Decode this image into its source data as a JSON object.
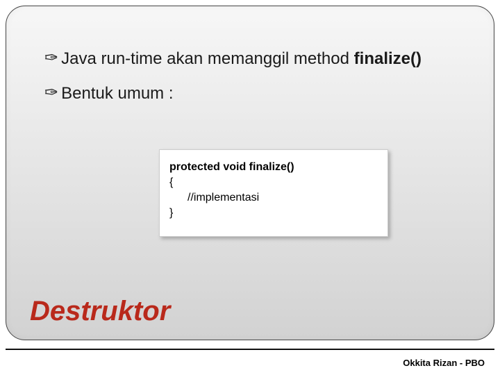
{
  "bullets": [
    {
      "prefix": "Java run-time akan memanggil method ",
      "strong": "finalize()"
    },
    {
      "prefix": "Bentuk umum :",
      "strong": ""
    }
  ],
  "code": {
    "signature": "protected void finalize()",
    "open": "{",
    "body": "//implementasi",
    "close": "}"
  },
  "title": "Destruktor",
  "footer": "Okkita Rizan - PBO"
}
